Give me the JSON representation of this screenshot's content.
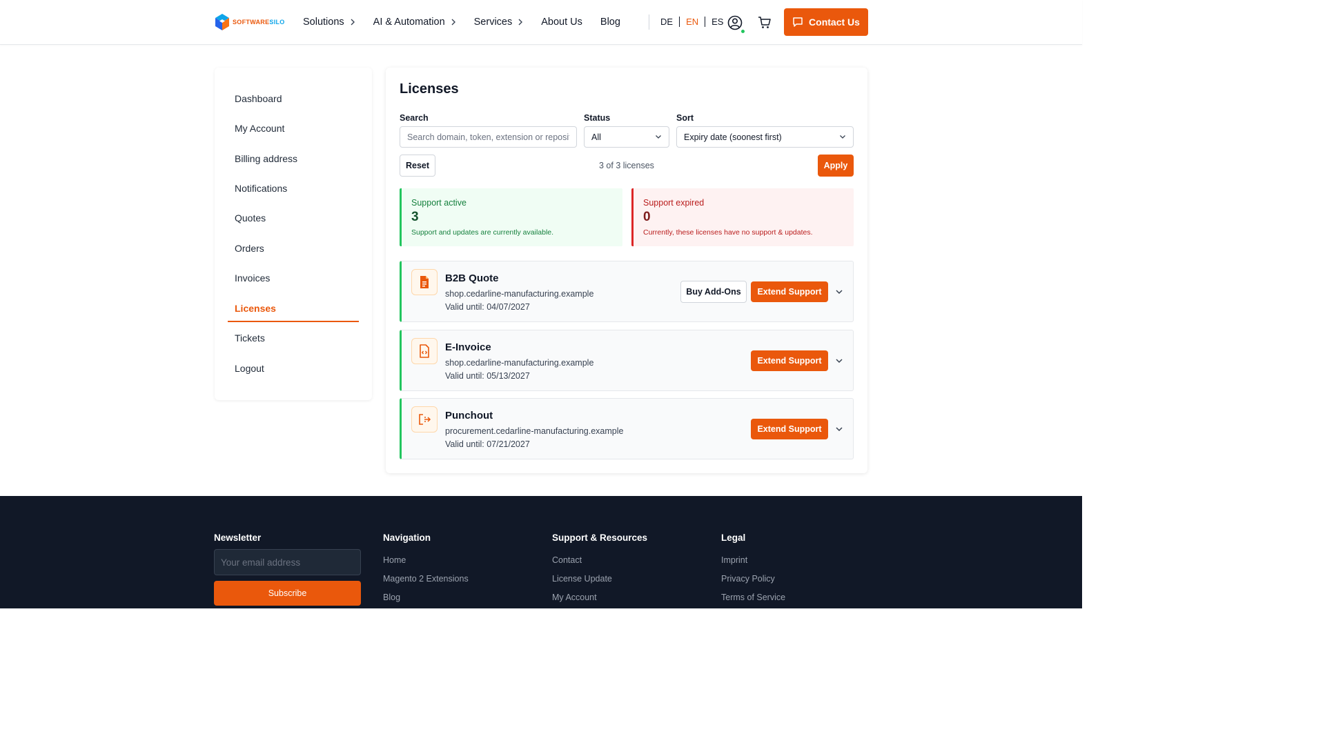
{
  "header": {
    "logo_text_a": "SOFTWARE",
    "logo_text_b": "SILO",
    "nav": [
      {
        "label": "Solutions",
        "has_chevron": true
      },
      {
        "label": "AI & Automation",
        "has_chevron": true
      },
      {
        "label": "Services",
        "has_chevron": true
      },
      {
        "label": "About Us",
        "has_chevron": false
      },
      {
        "label": "Blog",
        "has_chevron": false
      }
    ],
    "languages": [
      {
        "code": "DE",
        "active": false
      },
      {
        "code": "EN",
        "active": true
      },
      {
        "code": "ES",
        "active": false
      }
    ],
    "contact_label": "Contact Us"
  },
  "sidebar": {
    "items": [
      {
        "label": "Dashboard"
      },
      {
        "label": "My Account"
      },
      {
        "label": "Billing address"
      },
      {
        "label": "Notifications"
      },
      {
        "label": "Quotes"
      },
      {
        "label": "Orders"
      },
      {
        "label": "Invoices"
      },
      {
        "label": "Licenses",
        "active": true
      },
      {
        "label": "Tickets"
      },
      {
        "label": "Logout"
      }
    ]
  },
  "main": {
    "title": "Licenses",
    "filters": {
      "search_label": "Search",
      "search_placeholder": "Search domain, token, extension or repository",
      "status_label": "Status",
      "status_value": "All",
      "sort_label": "Sort",
      "sort_value": "Expiry date (soonest first)",
      "reset_label": "Reset",
      "count_text": "3 of 3 licenses",
      "apply_label": "Apply"
    },
    "stats": {
      "active": {
        "label": "Support active",
        "count": "3",
        "desc": "Support and updates are currently available."
      },
      "expired": {
        "label": "Support expired",
        "count": "0",
        "desc": "Currently, these licenses have no support & updates."
      }
    },
    "licenses": [
      {
        "name": "B2B Quote",
        "domain": "shop.cedarline-manufacturing.example",
        "valid": "Valid until: 04/07/2027",
        "icon": "document-icon",
        "addons_label": "Buy Add-Ons",
        "extend_label": "Extend Support"
      },
      {
        "name": "E-Invoice",
        "domain": "shop.cedarline-manufacturing.example",
        "valid": "Valid until: 05/13/2027",
        "icon": "code-file-icon",
        "extend_label": "Extend Support"
      },
      {
        "name": "Punchout",
        "domain": "procurement.cedarline-manufacturing.example",
        "valid": "Valid until: 07/21/2027",
        "icon": "punchout-icon",
        "extend_label": "Extend Support"
      }
    ]
  },
  "footer": {
    "newsletter": {
      "heading": "Newsletter",
      "placeholder": "Your email address",
      "button": "Subscribe"
    },
    "navigation": {
      "heading": "Navigation",
      "links": [
        "Home",
        "Magento 2 Extensions",
        "Blog"
      ]
    },
    "support": {
      "heading": "Support & Resources",
      "links": [
        "Contact",
        "License Update",
        "My Account"
      ]
    },
    "legal": {
      "heading": "Legal",
      "links": [
        "Imprint",
        "Privacy Policy",
        "Terms of Service"
      ]
    }
  },
  "colors": {
    "accent": "#ea580c",
    "success": "#22c55e",
    "danger": "#dc2626",
    "footer_bg": "#111827"
  }
}
